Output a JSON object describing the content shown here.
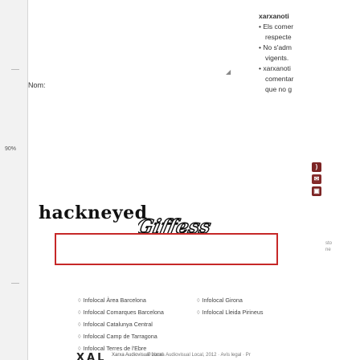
{
  "form": {
    "nom_label": "Nom:"
  },
  "sidebar_right": {
    "lines": [
      "xarxanoti",
      "• Els comer",
      "respecte",
      "• No s'adm",
      "vigents.",
      "• xarxanoti",
      "comentar",
      "que no g"
    ]
  },
  "left_strip": {
    "percent": "90%"
  },
  "captcha": {
    "text_label": "hackneyed",
    "image_text": "Giffess",
    "input_value": ""
  },
  "share": {
    "icons": [
      "rss-icon",
      "mail-icon",
      "print-icon"
    ],
    "color": "#7c2424"
  },
  "links": {
    "col1": [
      "Infolocal Àrea Barcelona",
      "Infolocal Comarques Barcelona",
      "Infolocal Catalunya Central",
      "Infolocal Camp de Tarragona",
      "Infolocal Terres de l'Ebre"
    ],
    "col2": [
      "Infolocal Girona",
      "Infolocal Lleida Pirineus"
    ]
  },
  "footer": {
    "logo": "XAL",
    "subtitle": "Xarxa Audiovisual Local",
    "text": "© Xarxa Audiovisual Local, 2012 · Avís legal · Pr"
  }
}
